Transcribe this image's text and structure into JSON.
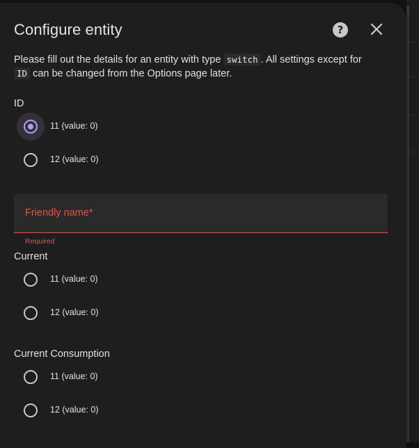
{
  "dialog": {
    "title": "Configure entity",
    "description_before": "Please fill out the details for an entity with type ",
    "description_type": "switch",
    "description_middle": ". All settings except for ",
    "description_id": "ID",
    "description_after": " can be changed from the Options page later."
  },
  "fields": {
    "id": {
      "label": "ID",
      "options": [
        {
          "label": "11 (value: 0)",
          "checked": true
        },
        {
          "label": "12 (value: 0)",
          "checked": false
        }
      ]
    },
    "friendly_name": {
      "label": "Friendly name*",
      "helper": "Required",
      "value": ""
    },
    "current": {
      "label": "Current",
      "options": [
        {
          "label": "11 (value: 0)",
          "checked": false
        },
        {
          "label": "12 (value: 0)",
          "checked": false
        }
      ]
    },
    "current_consumption": {
      "label": "Current Consumption",
      "options": [
        {
          "label": "11 (value: 0)",
          "checked": false
        },
        {
          "label": "12 (value: 0)",
          "checked": false
        }
      ]
    }
  },
  "icons": {
    "help": "help-circle-icon",
    "close": "close-icon"
  },
  "colors": {
    "accent": "#b49cf0",
    "error": "#d9574d",
    "surface": "#1e1e1e"
  }
}
